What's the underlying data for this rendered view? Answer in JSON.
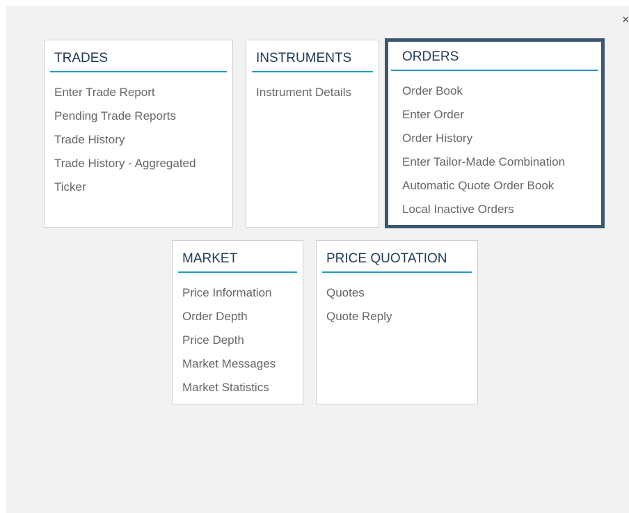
{
  "close_label": "×",
  "colors": {
    "heading": "#1f3a56",
    "rule": "#1f9bc7",
    "highlight_border": "#3d5672",
    "link_text": "#666666"
  },
  "panels": [
    {
      "title": "TRADES",
      "items": [
        "Enter Trade Report",
        "Pending Trade Reports",
        "Trade History",
        "Trade History - Aggregated",
        "Ticker"
      ]
    },
    {
      "title": "INSTRUMENTS",
      "items": [
        "Instrument Details"
      ]
    },
    {
      "title": "ORDERS",
      "highlighted": true,
      "items": [
        "Order Book",
        "Enter Order",
        "Order History",
        "Enter Tailor-Made Combination",
        "Automatic Quote Order Book",
        "Local Inactive Orders"
      ]
    },
    {
      "title": "MARKET",
      "items": [
        "Price Information",
        "Order Depth",
        "Price Depth",
        "Market Messages",
        "Market Statistics"
      ]
    },
    {
      "title": "PRICE QUOTATION",
      "items": [
        "Quotes",
        "Quote Reply"
      ]
    }
  ]
}
